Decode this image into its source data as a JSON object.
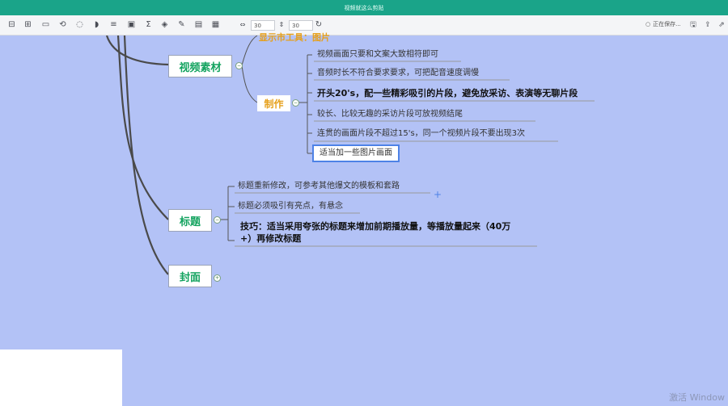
{
  "window": {
    "title": "视频就这么剪贴"
  },
  "toolbar": {
    "icons": [
      "topic-icon",
      "subtopic-icon",
      "boundary-icon",
      "link-icon",
      "comment-icon",
      "callout-icon",
      "summary-icon",
      "image-icon",
      "formula-icon",
      "tag-icon",
      "pen-icon",
      "note-icon",
      "template-icon"
    ],
    "width_value": "30",
    "height_value": "30",
    "status": "正在保存...",
    "right_icons": [
      "save-icon",
      "export-icon",
      "share-icon"
    ]
  },
  "mindmap": {
    "partial_top": "显示市工具：图片",
    "video": {
      "label": "视频素材",
      "sub_label": "制作",
      "leaves": [
        "视频画面只要和文案大致相符即可",
        "音频时长不符合要求要求，可把配音速度调慢",
        "开头20's，配一些精彩吸引的片段，避免放采访、表演等无聊片段",
        "较长、比较无趣的采访片段可放视频结尾",
        "连贯的画面片段不超过15's，同一个视频片段不要出现3次",
        "适当加一些图片画面"
      ]
    },
    "title_node": {
      "label": "标题",
      "leaves": [
        "标题重新修改，可参考其他爆文的模板和套路",
        "标题必须吸引有亮点，有悬念",
        "技巧：适当采用夸张的标题来增加前期播放量，等播放量起来（40万",
        "+）再修改标题"
      ]
    },
    "cover_node": {
      "label": "封面"
    }
  },
  "watermark": "激活 Window"
}
